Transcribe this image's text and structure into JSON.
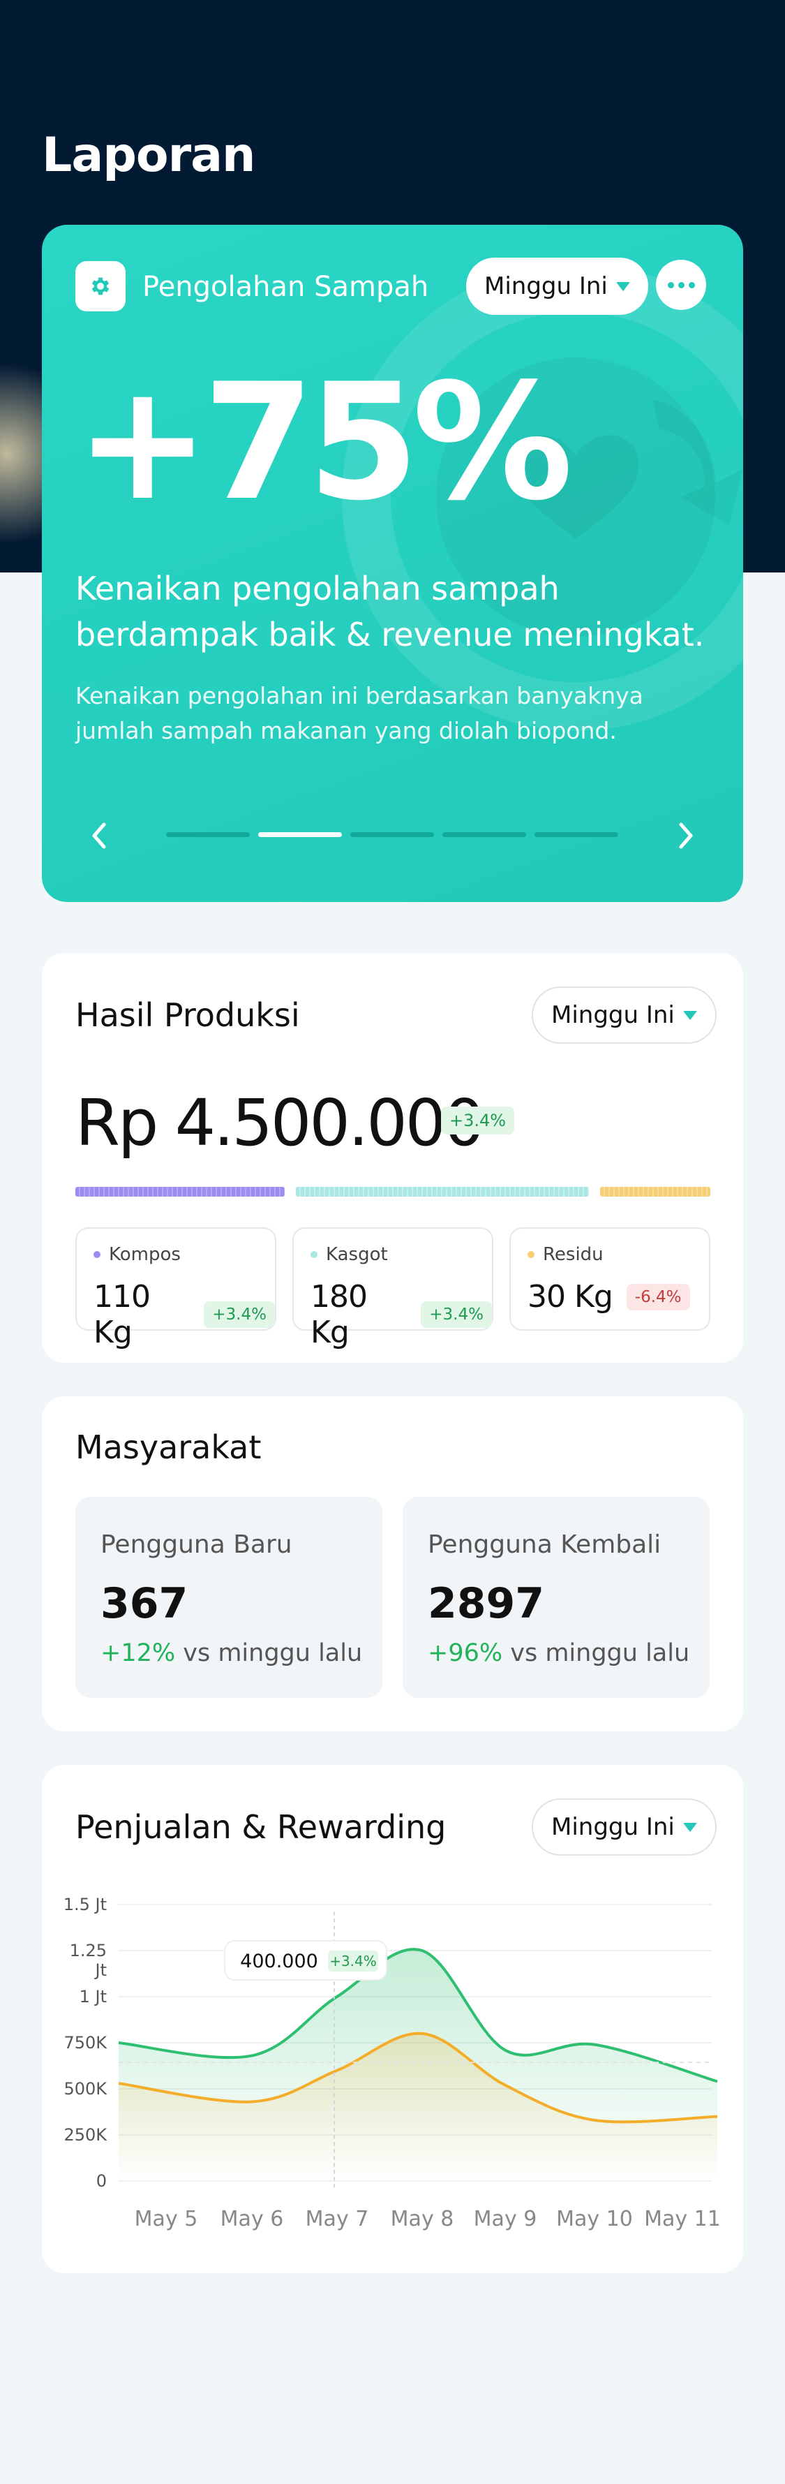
{
  "page": {
    "title": "Laporan"
  },
  "hero": {
    "card_title": "Pengolahan Sampah",
    "period": "Minggu Ini",
    "big_value": "+75%",
    "headline": "Kenaikan pengolahan sampah berdampak baik & revenue meningkat.",
    "subtitle": "Kenaikan pengolahan ini berdasarkan banyaknya jumlah sampah makanan yang diolah biopond.",
    "carousel": {
      "pages": 5,
      "active_index": 1
    },
    "colors": {
      "card": "#22c9b8",
      "active_dot": "#ffffff",
      "dot": "#13a99a"
    }
  },
  "production": {
    "title": "Hasil Produksi",
    "period": "Minggu Ini",
    "amount": "Rp 4.500.000",
    "change": "+3.4%",
    "items": [
      {
        "label": "Kompos",
        "value": "110 Kg",
        "change": "+3.4%",
        "color": "#9b8df0",
        "trend": "up"
      },
      {
        "label": "Kasgot",
        "value": "180 Kg",
        "change": "+3.4%",
        "color": "#a8e6e4",
        "trend": "up"
      },
      {
        "label": "Residu",
        "value": "30 Kg",
        "change": "-6.4%",
        "color": "#f6cf74",
        "trend": "down"
      }
    ]
  },
  "community": {
    "title": "Masyarakat",
    "stats": [
      {
        "label": "Pengguna Baru",
        "value": "367",
        "delta": "+12%",
        "suffix": " vs minggu lalu"
      },
      {
        "label": "Pengguna Kembali",
        "value": "2897",
        "delta": "+96%",
        "suffix": " vs minggu lalu"
      }
    ]
  },
  "sales": {
    "title": "Penjualan & Rewarding",
    "period": "Minggu Ini",
    "tooltip": {
      "value": "400.000",
      "change": "+3.4%"
    }
  },
  "chart_data": {
    "type": "line",
    "title": "Penjualan & Rewarding",
    "y_ticks": [
      "0",
      "250K",
      "500K",
      "750K",
      "1 Jt",
      "1.25 Jt",
      "1.5 Jt"
    ],
    "categories": [
      "May 5",
      "May 6",
      "May 7",
      "May 8",
      "May 9",
      "May 10",
      "May 11"
    ],
    "ylim": [
      0,
      1500000
    ],
    "grid": true,
    "series": [
      {
        "color": "#2fbf71",
        "values": [
          750000,
          680000,
          1000000,
          1250000,
          710000,
          740000,
          540000
        ]
      },
      {
        "color": "#f4ad2a",
        "values": [
          530000,
          430000,
          600000,
          800000,
          520000,
          330000,
          350000
        ]
      }
    ],
    "highlight": {
      "category": "May 7",
      "value": 400000,
      "label": "400.000",
      "change": "+3.4%"
    }
  }
}
